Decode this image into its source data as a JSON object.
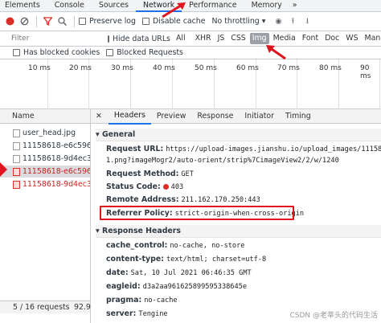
{
  "tabs": [
    "Elements",
    "Console",
    "Sources",
    "Network",
    "Performance",
    "Memory"
  ],
  "active_tab": "Network",
  "toolbar": {
    "preserve_log": "Preserve log",
    "disable_cache": "Disable cache",
    "throttling": "No throttling"
  },
  "filter": {
    "placeholder": "Filter",
    "hide_data_urls": "Hide data URLs",
    "types": [
      "All",
      "XHR",
      "JS",
      "CSS",
      "Img",
      "Media",
      "Font",
      "Doc",
      "WS",
      "Manifest"
    ],
    "active_type": "Img"
  },
  "blocked": {
    "has_blocked_cookies": "Has blocked cookies",
    "blocked_requests": "Blocked Requests"
  },
  "timeline_ticks": [
    "10 ms",
    "20 ms",
    "30 ms",
    "40 ms",
    "50 ms",
    "60 ms",
    "70 ms",
    "80 ms",
    "90 ms"
  ],
  "requests": {
    "header": "Name",
    "items": [
      {
        "name": "user_head.jpg",
        "error": false,
        "selected": false
      },
      {
        "name": "11158618-e6c596...",
        "error": false,
        "selected": false
      },
      {
        "name": "11158618-9d4ec3...",
        "error": false,
        "selected": false
      },
      {
        "name": "11158618-e6c596...",
        "error": true,
        "selected": true
      },
      {
        "name": "11158618-9d4ec3...",
        "error": true,
        "selected": false
      }
    ],
    "status": "5 / 16 requests",
    "status_size": "92.9"
  },
  "detail_tabs": [
    "Headers",
    "Preview",
    "Response",
    "Initiator",
    "Timing"
  ],
  "active_detail_tab": "Headers",
  "general": {
    "title": "General",
    "request_url_label": "Request URL:",
    "request_url_1": "https://upload-images.jianshu.io/upload_images/11158618-",
    "request_url_2": "1.png?imageMogr2/auto-orient/strip%7CimageView2/2/w/1240",
    "method_label": "Request Method:",
    "method": "GET",
    "status_label": "Status Code:",
    "status": "403",
    "remote_label": "Remote Address:",
    "remote": "211.162.170.250:443",
    "referrer_label": "Referrer Policy:",
    "referrer": "strict-origin-when-cross-origin"
  },
  "response_headers": {
    "title": "Response Headers",
    "items": [
      {
        "k": "cache_control:",
        "v": "no-cache, no-store"
      },
      {
        "k": "content-type:",
        "v": "text/html; charset=utf-8"
      },
      {
        "k": "date:",
        "v": "Sat, 10 Jul 2021 06:46:35 GMT"
      },
      {
        "k": "eagleid:",
        "v": "d3a2aa961625899595338645e"
      },
      {
        "k": "pragma:",
        "v": "no-cache"
      },
      {
        "k": "server:",
        "v": "Tengine"
      }
    ]
  },
  "watermark": "CSDN @老莘头的代码生活",
  "colors": {
    "accent": "#1a73e8",
    "highlight_red": "#e0151d",
    "error_text": "#c5221f"
  }
}
